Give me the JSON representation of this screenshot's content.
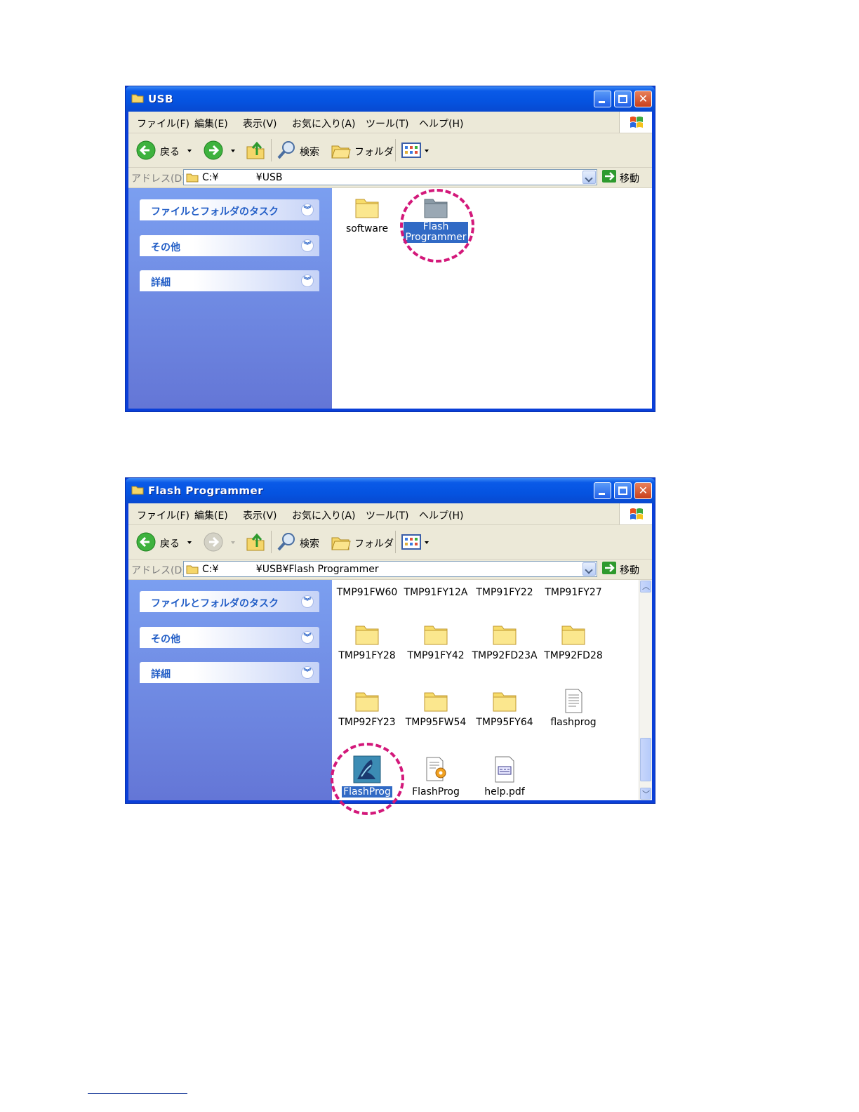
{
  "menu": [
    "ファイル(F)",
    "編集(E)",
    "表示(V)",
    "お気に入り(A)",
    "ツール(T)",
    "ヘルプ(H)"
  ],
  "toolbar": {
    "back": "戻る",
    "search": "検索",
    "folders": "フォルダ"
  },
  "address": {
    "label": "アドレス(D)",
    "go": "移動"
  },
  "taskpane": [
    "ファイルとフォルダのタスク",
    "その他",
    "詳細"
  ],
  "window1": {
    "title": "USB",
    "address": "C:¥            ¥USB",
    "items": [
      {
        "label": "software"
      },
      {
        "label1": "Flash",
        "label2": "Programmer"
      }
    ]
  },
  "window2": {
    "title": "Flash Programmer",
    "address": "C:¥            ¥USB¥Flash Programmer",
    "row1": [
      "TMP91FW60",
      "TMP91FY12A",
      "TMP91FY22",
      "TMP91FY27"
    ],
    "row2": [
      "TMP91FY28",
      "TMP91FY42",
      "TMP92FD23A",
      "TMP92FD28"
    ],
    "row3": [
      "TMP92FY23",
      "TMP95FW54",
      "TMP95FY64",
      "flashprog"
    ],
    "row4": [
      "FlashProg",
      "FlashProg",
      "help.pdf"
    ]
  },
  "colors": {
    "titlebar": "#0553e0",
    "selection": "#316ac5",
    "highlight_circle": "#d3187a",
    "taskpane": "#7b9ff0"
  }
}
